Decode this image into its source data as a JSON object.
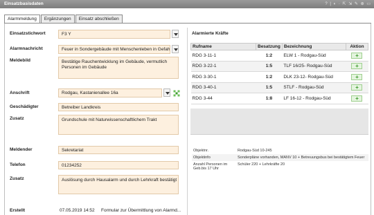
{
  "window": {
    "title": "Einsatzbasisdaten",
    "controls": "? | ◐ · ⇱ ⇲ ✎ ⊕ ▭"
  },
  "tabs": [
    {
      "label": "Alarmmeldung"
    },
    {
      "label": "Ergänzungen"
    },
    {
      "label": "Einsatz abschließen"
    }
  ],
  "form": {
    "einsatzstichwort": {
      "label": "Einsatzstichwort",
      "value": "F3 Y"
    },
    "alarmnachricht": {
      "label": "Alarmnachricht",
      "value": "Feuer in Sondergebäude mit Menschenleben in Gefah"
    },
    "meldebild": {
      "label": "Meldebild",
      "value": "Bestätige Rauchentwicklung im Gebäude, vermutlich Personen im Gebäude"
    },
    "anschrift": {
      "label": "Anschrift",
      "value": "Rodgau, Kastanienallee 16a"
    },
    "geschaedigter": {
      "label": "Geschädigter",
      "value": "Betreiber Landkreis"
    },
    "zusatz1": {
      "label": "Zusatz",
      "value": "Grundschule mit Naturwissenschaftlichem Trakt"
    },
    "meldender": {
      "label": "Meldender",
      "value": "Sekretariat"
    },
    "telefon": {
      "label": "Telefon",
      "value": "01234252"
    },
    "zusatz2": {
      "label": "Zusatz",
      "value": "Auslösung durch Hausalarm und durch Lehrkraft bestätigt"
    },
    "erstellt": {
      "label": "Erstellt",
      "value": "07.05.2019 14:52",
      "note": "Formular zur Übermittlung von Alarmd..."
    }
  },
  "alarmierte": {
    "title": "Alarmierte Kräfte",
    "columns": [
      "Rufname",
      "Besatzung",
      "Bezeichnung",
      "Aktion"
    ],
    "rows": [
      {
        "rufname": "RDG 3-11-1",
        "besatzung": "1:2",
        "bezeichnung": "ELW 1 - Rodgau-Süd",
        "aktion": "+"
      },
      {
        "rufname": "RDG 3-22-1",
        "besatzung": "1:5",
        "bezeichnung": "TLF 16/25- Rodgau-Süd",
        "aktion": "+"
      },
      {
        "rufname": "RDG 3-30-1",
        "besatzung": "1:2",
        "bezeichnung": "DLK 23-12- Rodgau-Süd",
        "aktion": "+"
      },
      {
        "rufname": "RDG 3-40-1",
        "besatzung": "1:5",
        "bezeichnung": "STLF - Rodgau-Süd",
        "aktion": "+"
      },
      {
        "rufname": "RDG 3-44",
        "besatzung": "1:8",
        "bezeichnung": "LF 16-12 - Rodgau-Süd",
        "aktion": "+"
      }
    ]
  },
  "objekt": [
    {
      "key": "Objektnr.",
      "value": "Rodgau-Süd 10-245"
    },
    {
      "key": "Objektinfo",
      "value": "Sonderpläne vorhanden, MANV 10 + Betreuungsbus bei bestätigtem Feuer"
    },
    {
      "key": "Anzahl Personen im Geb.bis 17 Uhr",
      "value": "Schüler 220 + Lehrkräfte 20"
    }
  ],
  "colors": {
    "accent": "#fdf0df",
    "add_green": "#3a9a2a",
    "titlebar": "#8a8a8a"
  }
}
